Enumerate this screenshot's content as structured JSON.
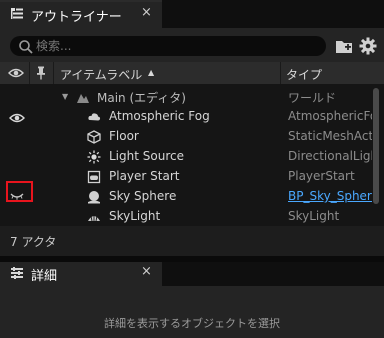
{
  "outliner": {
    "tab_title": "アウトライナー",
    "tab_close": "×",
    "search_placeholder": "検索...",
    "header": {
      "item_label": "アイテムラベル",
      "sort_indicator": "▲",
      "type": "タイプ"
    },
    "rows": [
      {
        "label": "Main (エディタ)",
        "type": "ワールド",
        "icon": "world-icon",
        "visible": false
      },
      {
        "label": "Atmospheric Fog",
        "type": "AtmosphericFog",
        "icon": "cloud-icon",
        "visible": true
      },
      {
        "label": "Floor",
        "type": "StaticMeshActor",
        "icon": "cube-icon",
        "visible": false
      },
      {
        "label": "Light Source",
        "type": "DirectionalLight",
        "icon": "sun-icon",
        "visible": false
      },
      {
        "label": "Player Start",
        "type": "PlayerStart",
        "icon": "gamepad-icon",
        "visible": false
      },
      {
        "label": "Sky Sphere",
        "type": "BP_Sky_Sphere",
        "type_is_link": true,
        "icon": "sky-sphere-icon",
        "visible": false,
        "hidden_eye": true
      },
      {
        "label": "SkyLight",
        "type": "SkyLight",
        "icon": "skylight-icon",
        "visible": false
      }
    ],
    "status": "7 アクタ"
  },
  "details": {
    "tab_title": "詳細",
    "tab_close": "×",
    "empty_message": "詳細を表示するオブジェクトを選択"
  },
  "colors": {
    "accent_link": "#4aa8ff",
    "highlight_box": "#e8141d",
    "background": "#151515",
    "panel": "#242424"
  }
}
